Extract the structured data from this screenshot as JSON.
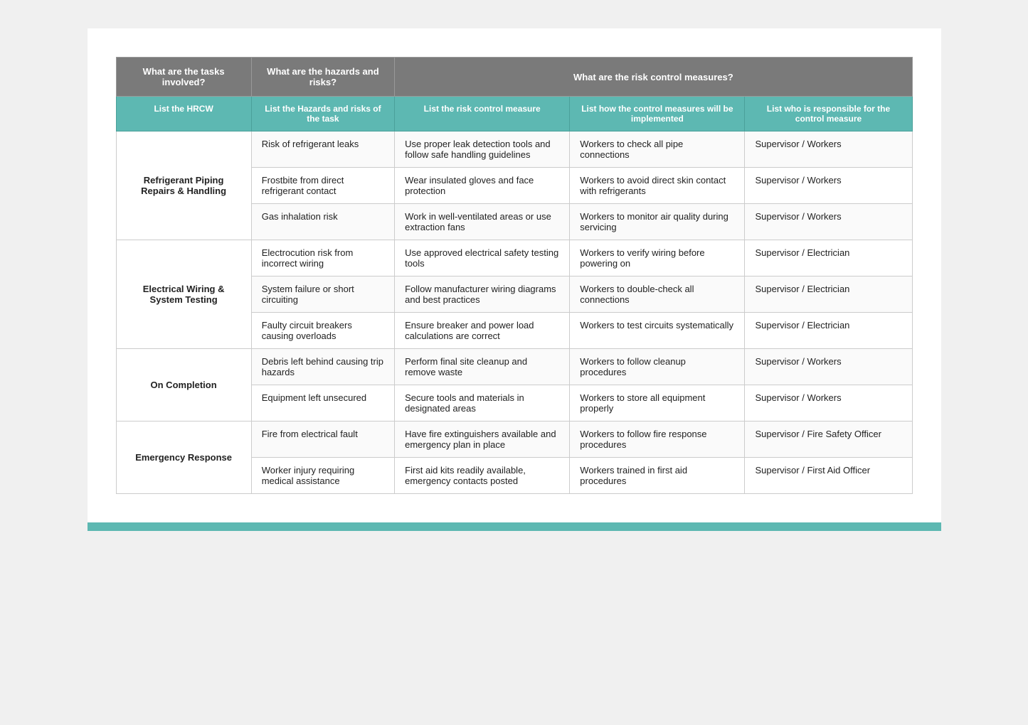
{
  "header": {
    "col1": "What are the tasks involved?",
    "col2": "What are the hazards and risks?",
    "col3_span": "What are the risk control measures?"
  },
  "subheader": {
    "col1": "List the HRCW",
    "col2": "List the Hazards and risks of the task",
    "col3": "List the risk control measure",
    "col4": "List how the control measures will be implemented",
    "col5": "List who is responsible for the control measure"
  },
  "rows": [
    {
      "task": "Refrigerant Piping\nRepairs & Handling",
      "task_rowspan": 3,
      "hazard": "Risk of refrigerant leaks",
      "control": "Use proper leak detection tools and follow safe handling guidelines",
      "implement": "Workers to check all pipe connections",
      "responsible": "Supervisor / Workers"
    },
    {
      "task": "",
      "hazard": "Frostbite from direct refrigerant contact",
      "control": "Wear insulated gloves and face protection",
      "implement": "Workers to avoid direct skin contact with refrigerants",
      "responsible": "Supervisor / Workers"
    },
    {
      "task": "",
      "hazard": "Gas inhalation risk",
      "control": "Work in well-ventilated areas or use extraction fans",
      "implement": "Workers to monitor air quality during servicing",
      "responsible": "Supervisor / Workers"
    },
    {
      "task": "Electrical Wiring &\nSystem Testing",
      "task_rowspan": 3,
      "hazard": "Electrocution risk from incorrect wiring",
      "control": "Use approved electrical safety testing tools",
      "implement": "Workers to verify wiring before powering on",
      "responsible": "Supervisor / Electrician"
    },
    {
      "task": "",
      "hazard": "System failure or short circuiting",
      "control": "Follow manufacturer wiring diagrams and best practices",
      "implement": "Workers to double-check all connections",
      "responsible": "Supervisor / Electrician"
    },
    {
      "task": "",
      "hazard": "Faulty circuit breakers causing overloads",
      "control": "Ensure breaker and power load calculations are correct",
      "implement": "Workers to test circuits systematically",
      "responsible": "Supervisor / Electrician"
    },
    {
      "task": "On Completion",
      "task_rowspan": 2,
      "hazard": "Debris left behind causing trip hazards",
      "control": "Perform final site cleanup and remove waste",
      "implement": "Workers to follow cleanup procedures",
      "responsible": "Supervisor / Workers"
    },
    {
      "task": "",
      "hazard": "Equipment left unsecured",
      "control": "Secure tools and materials in designated areas",
      "implement": "Workers to store all equipment properly",
      "responsible": "Supervisor / Workers"
    },
    {
      "task": "Emergency Response",
      "task_rowspan": 2,
      "hazard": "Fire from electrical fault",
      "control": "Have fire extinguishers available and emergency plan in place",
      "implement": "Workers to follow fire response procedures",
      "responsible": "Supervisor / Fire Safety Officer"
    },
    {
      "task": "",
      "hazard": "Worker injury requiring medical assistance",
      "control": "First aid kits readily available, emergency contacts posted",
      "implement": "Workers trained in first aid procedures",
      "responsible": "Supervisor / First Aid Officer"
    }
  ]
}
